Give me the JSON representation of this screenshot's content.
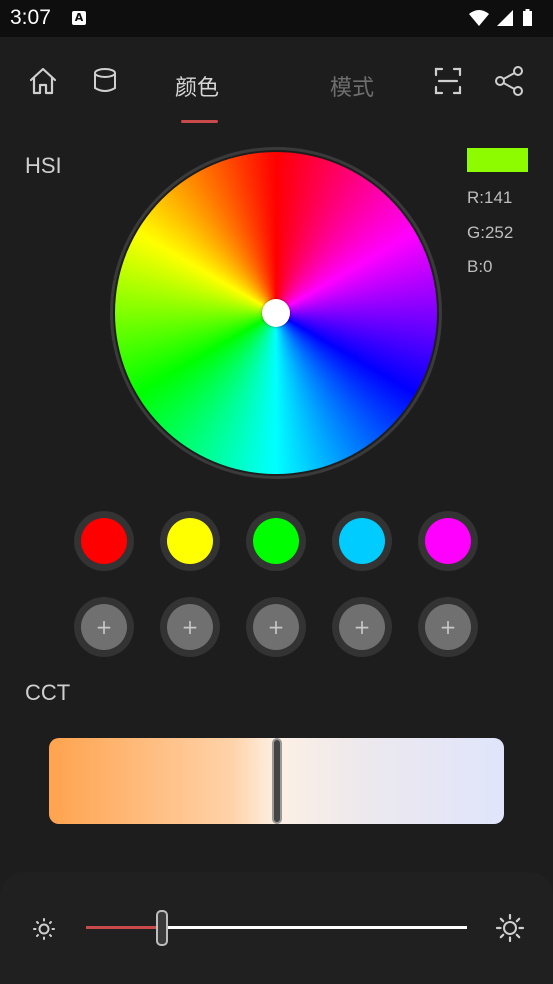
{
  "status_bar": {
    "time": "3:07",
    "notification_icon": "a-icon",
    "icons": [
      "wifi-icon",
      "signal-icon",
      "battery-icon"
    ]
  },
  "header": {
    "home_icon": "home-icon",
    "device_icon": "lamp-icon",
    "tabs": [
      {
        "label": "颜色",
        "active": true
      },
      {
        "label": "模式",
        "active": false
      }
    ],
    "scan_icon": "scan-icon",
    "share_icon": "share-icon",
    "accent_color": "#c94a4a"
  },
  "hsi": {
    "label": "HSI",
    "selected_color": "#8dfc00",
    "r": "R:141",
    "g": "G:252",
    "b": "B:0"
  },
  "presets": [
    {
      "color": "#ff0000"
    },
    {
      "color": "#ffff00"
    },
    {
      "color": "#00ff00"
    },
    {
      "color": "#00ccff"
    },
    {
      "color": "#ff00ff"
    }
  ],
  "custom_slots": [
    {
      "symbol": "+"
    },
    {
      "symbol": "+"
    },
    {
      "symbol": "+"
    },
    {
      "symbol": "+"
    },
    {
      "symbol": "+"
    }
  ],
  "cct": {
    "label": "CCT",
    "value_fraction": 0.5
  },
  "brightness": {
    "low_icon": "sun-small-icon",
    "high_icon": "sun-large-icon",
    "value_fraction": 0.2
  }
}
